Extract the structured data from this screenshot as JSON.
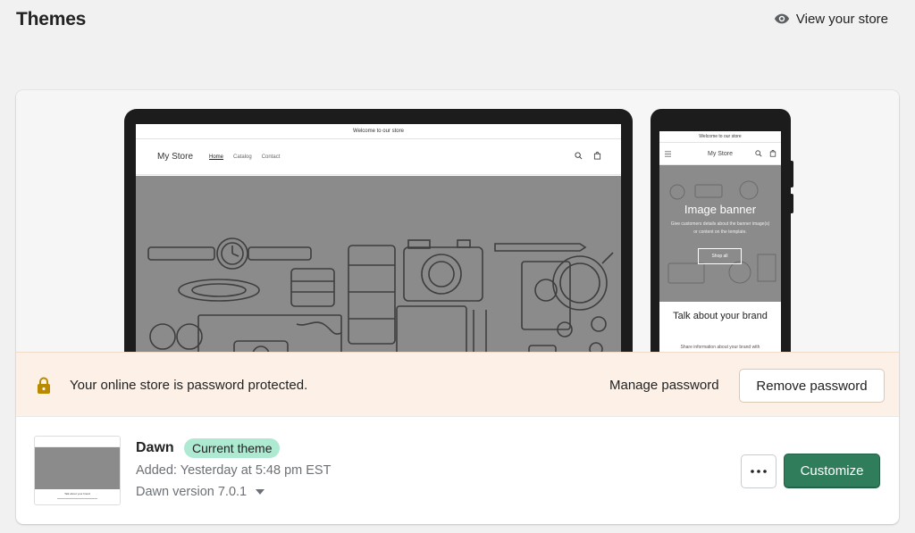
{
  "header": {
    "title": "Themes",
    "view_store_label": "View your store",
    "view_store_icon": "eye-icon"
  },
  "preview": {
    "desktop": {
      "announcement": "Welcome to our store",
      "store_name": "My Store",
      "nav": [
        "Home",
        "Catalog",
        "Contact"
      ]
    },
    "mobile": {
      "announcement": "Welcome to our store",
      "store_name": "My Store",
      "banner_title": "Image banner",
      "banner_subtitle": "Give customers details about the banner image(s) or content on the template.",
      "banner_button": "Shop all",
      "section_title": "Talk about your brand",
      "section_text": "Share information about your brand with"
    }
  },
  "password_banner": {
    "icon": "lock-icon",
    "message": "Your online store is password protected.",
    "manage_label": "Manage password",
    "remove_label": "Remove password",
    "background_color": "#fdf1e7"
  },
  "theme": {
    "name": "Dawn",
    "badge": "Current theme",
    "badge_color": "#aee9d1",
    "added": "Added: Yesterday at 5:48 pm EST",
    "version": "Dawn version 7.0.1",
    "thumb_text": "Talk about your brand",
    "more_label": "•••",
    "customize_label": "Customize",
    "customize_color": "#2f7d5b"
  }
}
